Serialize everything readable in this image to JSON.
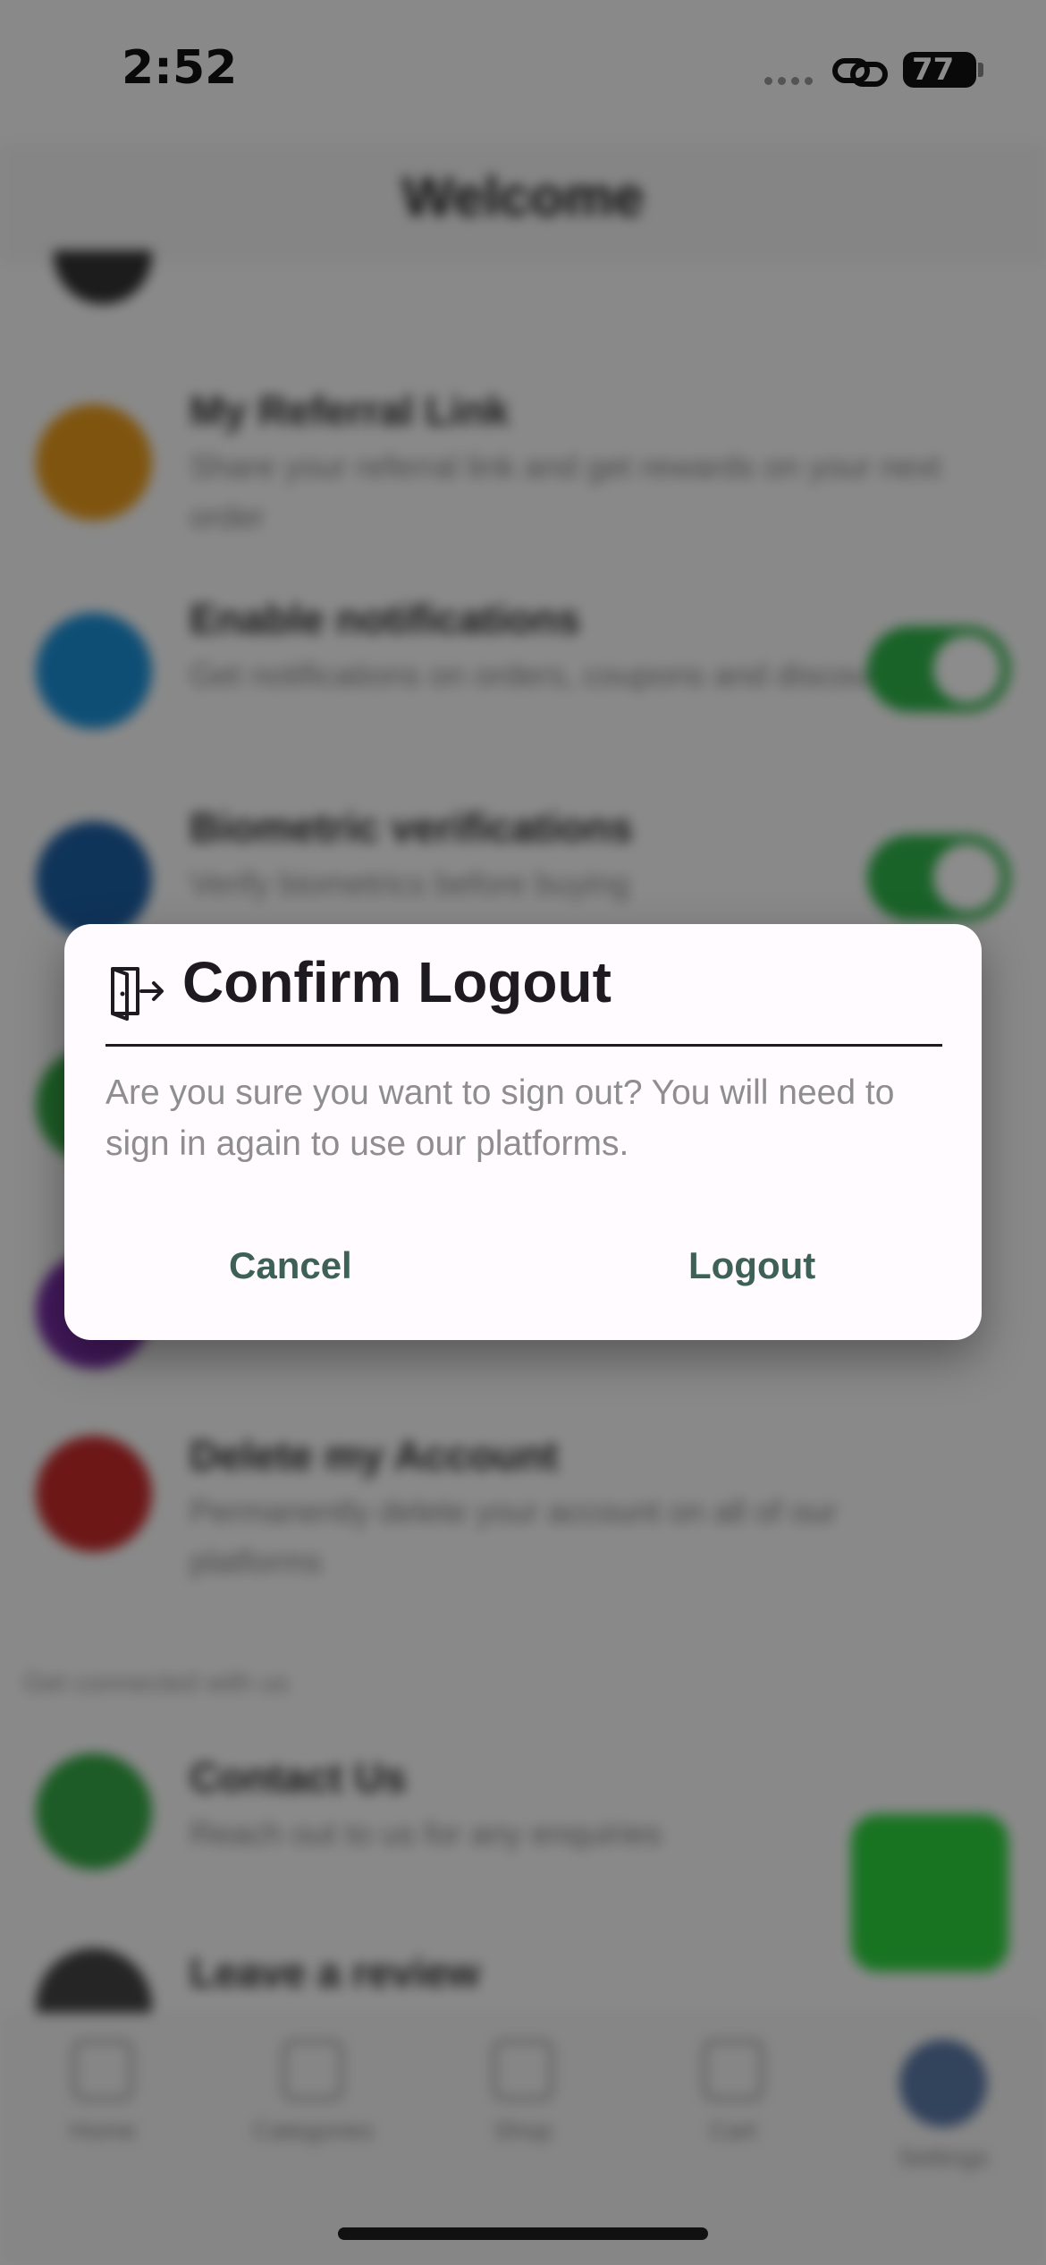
{
  "status_bar": {
    "time": "2:52",
    "battery": "77"
  },
  "header": {
    "title": "Welcome"
  },
  "background_list": {
    "items": [
      {
        "title": "My Referral Link",
        "description": "Share your referral link and get rewards on your next order",
        "color": "#e89a1c"
      },
      {
        "title": "Enable notifications",
        "description": "Get notifications on orders, coupons and discounts",
        "color": "#1b8fd6"
      },
      {
        "title": "Biometric verifications",
        "description": "Verify biometrics before buying",
        "color": "#1d5fa3"
      },
      {
        "title": "Delete my Account",
        "description": "Permanently delete your account on all of our platforms",
        "color": "#c62b2b"
      }
    ],
    "section_label": "Get connected with us",
    "contact": {
      "title": "Contact Us",
      "description": "Reach out to us for any enquiries",
      "color": "#35a845"
    },
    "review": {
      "title": "Leave a review"
    }
  },
  "tabs": [
    {
      "label": "Home"
    },
    {
      "label": "Categories"
    },
    {
      "label": "Shop"
    },
    {
      "label": "Cart"
    },
    {
      "label": "Settings"
    }
  ],
  "dialog": {
    "title": "Confirm Logout",
    "message": "Are you sure you want to sign out? You will need to sign in again to use our platforms.",
    "cancel_label": "Cancel",
    "logout_label": "Logout",
    "accent_color": "#3d6157"
  }
}
